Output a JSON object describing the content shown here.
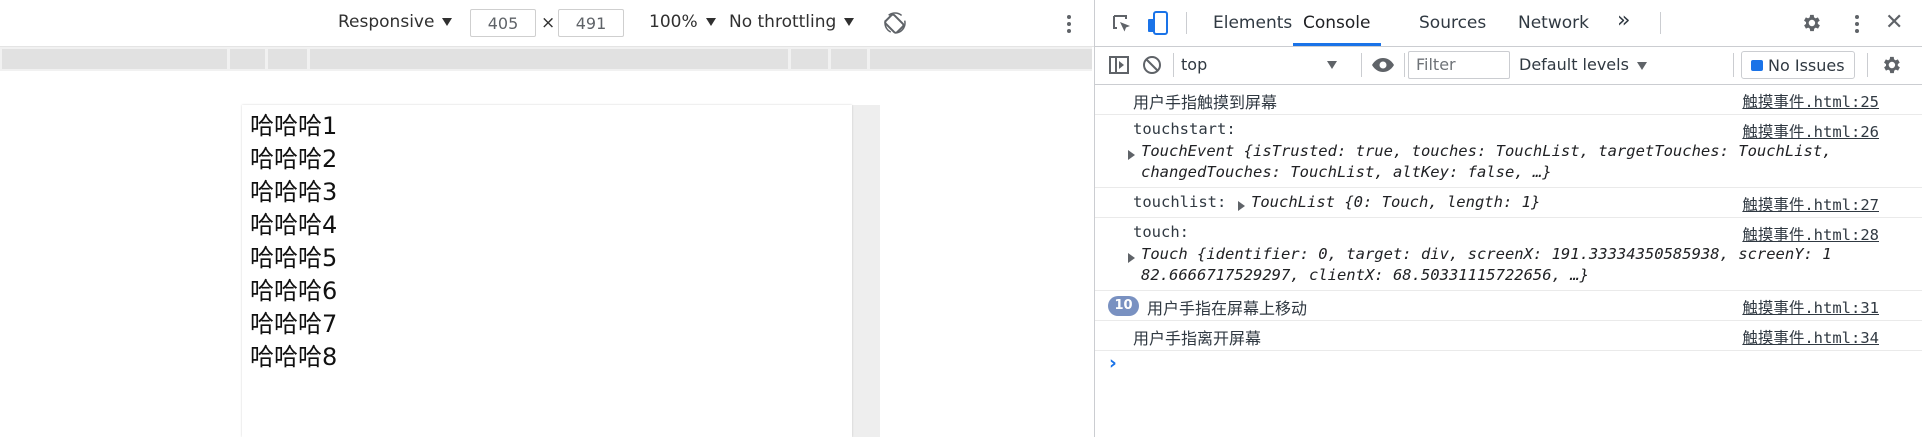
{
  "device_toolbar": {
    "device": "Responsive",
    "width": "405",
    "times": "×",
    "height": "491",
    "zoom": "100%",
    "throttling": "No throttling"
  },
  "page": {
    "lines": [
      "哈哈哈1",
      "哈哈哈2",
      "哈哈哈3",
      "哈哈哈4",
      "哈哈哈5",
      "哈哈哈6",
      "哈哈哈7",
      "哈哈哈8"
    ]
  },
  "devtools": {
    "tabs": [
      {
        "label": "Elements"
      },
      {
        "label": "Console"
      },
      {
        "label": "Sources"
      },
      {
        "label": "Network"
      }
    ],
    "more_tabs": "»"
  },
  "console_toolbar": {
    "context": "top",
    "filter_placeholder": "Filter",
    "levels": "Default levels",
    "issues": "No Issues"
  },
  "console": {
    "messages": [
      {
        "text": "用户手指触摸到屏幕",
        "source": "触摸事件.html:25"
      },
      {
        "text": "touchstart:",
        "source": "触摸事件.html:26",
        "detail_line1": "TouchEvent {isTrusted: true, touches: TouchList, targetTouches: TouchList,",
        "detail_line2": "changedTouches: TouchList, altKey: false, …}"
      },
      {
        "text": "touchlist:",
        "source": "触摸事件.html:27",
        "inline": "TouchList {0: Touch, length: 1}"
      },
      {
        "text": "touch:",
        "source": "触摸事件.html:28",
        "detail_line1": "Touch {identifier: 0, target: div, screenX: 191.33334350585938, screenY: 1",
        "detail_line2": "82.6666717529297, clientX: 68.50331115722656, …}"
      },
      {
        "text": "用户手指在屏幕上移动",
        "source": "触摸事件.html:31",
        "count": "10"
      },
      {
        "text": "用户手指离开屏幕",
        "source": "触摸事件.html:34"
      }
    ],
    "prompt": "›"
  },
  "colors": {
    "accent": "#1a73e8",
    "badge": "#7991c1",
    "keyword": "#1a1aa6"
  }
}
